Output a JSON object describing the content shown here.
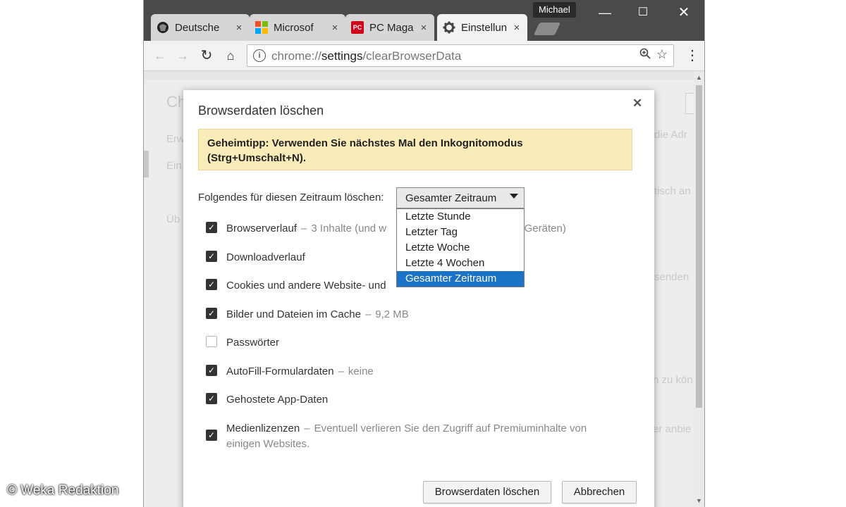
{
  "window": {
    "profile_name": "Michael",
    "tabs": [
      {
        "label": "Deutsche",
        "icon": "bundestag-eagle-icon"
      },
      {
        "label": "Microsof",
        "icon": "microsoft-logo-icon"
      },
      {
        "label": "PC Maga",
        "icon": "pcmag-logo-icon",
        "icon_text": "PC"
      },
      {
        "label": "Einstellun",
        "icon": "gear-icon",
        "active": true
      }
    ],
    "tab_close_glyph": "×"
  },
  "toolbar": {
    "url_prefix": "chrome://",
    "url_host": "settings",
    "url_path": "/clearBrowserData"
  },
  "background": {
    "ghost_texts": [
      "Ch",
      "Erw",
      "Ein",
      "Üb",
      "die Adr",
      "tisch an",
      "senden",
      "n zu kön",
      "er anbie"
    ]
  },
  "dialog": {
    "title": "Browserdaten löschen",
    "tip_line1": "Geheimtipp: Verwenden Sie nächstes Mal den Inkognitomodus",
    "tip_line2": "(Strg+Umschalt+N).",
    "range_label": "Folgendes für diesen Zeitraum löschen:",
    "range_selected": "Gesamter Zeitraum",
    "range_options": [
      "Letzte Stunde",
      "Letzter Tag",
      "Letzte Woche",
      "Letzte 4 Wochen",
      "Gesamter Zeitraum"
    ],
    "items": [
      {
        "label": "Browserverlauf",
        "detail": "3 Inhalte (und w",
        "detail_tail": "n Geräten)",
        "checked": true
      },
      {
        "label": "Downloadverlauf",
        "detail": "",
        "checked": true
      },
      {
        "label": "Cookies und andere Website- und",
        "detail": "",
        "checked": true
      },
      {
        "label": "Bilder und Dateien im Cache",
        "detail": "9,2 MB",
        "checked": true
      },
      {
        "label": "Passwörter",
        "detail": "",
        "checked": false
      },
      {
        "label": "AutoFill-Formulardaten",
        "detail": "keine",
        "checked": true
      },
      {
        "label": "Gehostete App-Daten",
        "detail": "",
        "checked": true
      },
      {
        "label": "Medienlizenzen",
        "detail": "Eventuell verlieren Sie den Zugriff auf Premiuminhalte von",
        "detail2": "einigen Websites.",
        "checked": true
      }
    ],
    "item_separator": "–",
    "confirm_label": "Browserdaten löschen",
    "cancel_label": "Abbrechen"
  },
  "credit": "© Weka Redaktion",
  "colors": {
    "tip_background": "#faecb8",
    "selected_option": "#1a73c7",
    "tabstrip": "#4a4a4a"
  }
}
